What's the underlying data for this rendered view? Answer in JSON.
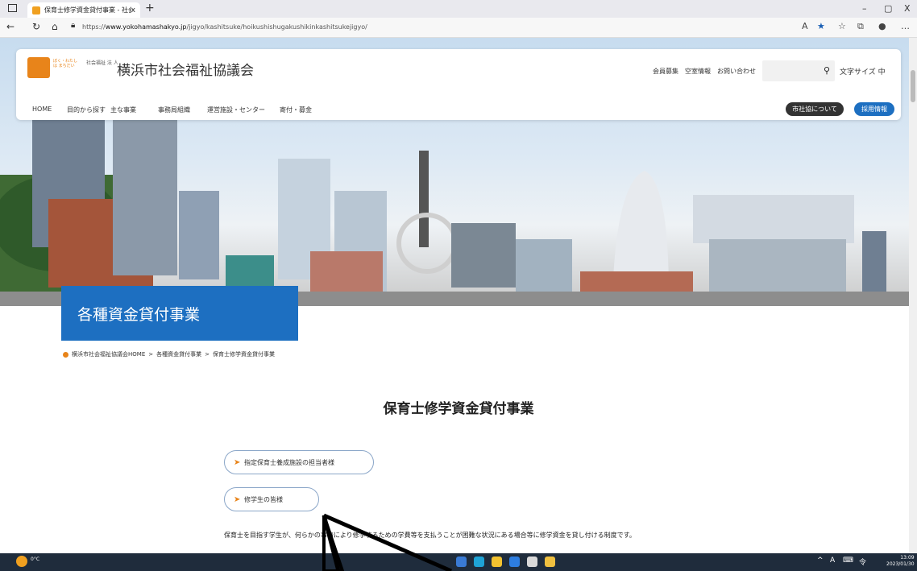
{
  "browser": {
    "tab_title": "保育士修学資金貸付事業 - 社会",
    "tab_close": "x",
    "new_tab": "+",
    "url_prefix": "https://",
    "url_domain": "www.yokohamashakyo.jp",
    "url_path": "/jigyo/kashitsuke/hoikushishugakushikinkashitsukejigyo/",
    "window_min": "–",
    "window_max": "▢",
    "window_close": "X"
  },
  "site": {
    "logo_text": "ぼく・わたしは まちだい",
    "corp_type": "社会福祉 法 人",
    "org_name": "横浜市社会福祉協議会",
    "util_links": [
      "会員募集",
      "空室情報",
      "お問い合わせ"
    ],
    "search_placeholder": "",
    "font_size_label": "文字サイズ 中",
    "gnav": [
      "HOME",
      "目的から探す",
      "主な事業",
      "事務局組織",
      "運営施設・センター",
      "寄付・募金"
    ],
    "about_button": "市社協について",
    "recruit_button": "採用情報"
  },
  "page": {
    "section_title": "各種資金貸付事業",
    "breadcrumb": [
      "横浜市社会福祉協議会HOME",
      ">",
      "各種資金貸付事業",
      ">",
      "保育士修学資金貸付事業"
    ],
    "heading": "保育士修学資金貸付事業",
    "pill_buttons": [
      "指定保育士養成施設の担当者様",
      "修学生の皆様"
    ],
    "body_line": "保育士を目指す学生が、何らかの事情により修学するための学費等を支払うことが困難な状況にある場合等に修学資金を貸し付ける制度です。"
  },
  "taskbar": {
    "temp": "0°C",
    "clock_time": "13:09",
    "clock_date": "2023/01/30",
    "tray_items": [
      "^",
      "A",
      "⌨",
      "令"
    ]
  },
  "colors": {
    "brand_orange": "#e8841a",
    "brand_blue": "#1d6fc1",
    "taskbar": "#1f2c3c"
  }
}
